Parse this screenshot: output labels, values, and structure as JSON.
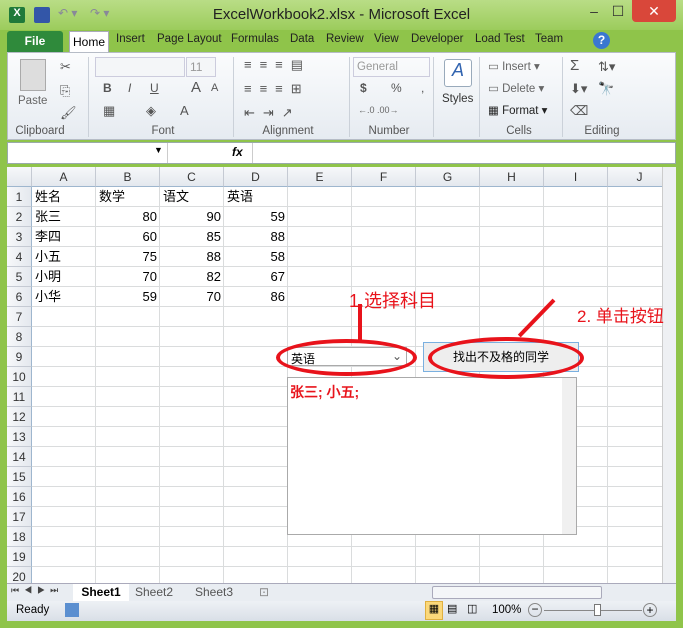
{
  "window": {
    "title": "ExcelWorkbook2.xlsx - Microsoft Excel",
    "minimize": "–",
    "maximize": "☐",
    "close": "✕"
  },
  "tabs": [
    "File",
    "Home",
    "Insert",
    "Page Layout",
    "Formulas",
    "Data",
    "Review",
    "View",
    "Developer",
    "Load Test",
    "Team"
  ],
  "ribbon": {
    "clipboard": {
      "label": "Clipboard",
      "paste": "Paste"
    },
    "font": {
      "label": "Font",
      "size": "11",
      "bold": "B",
      "italic": "I",
      "underline": "U",
      "grow": "A",
      "shrink": "A"
    },
    "alignment": {
      "label": "Alignment"
    },
    "number": {
      "label": "Number",
      "format": "General",
      "currency": "$",
      "percent": "%",
      "comma": ","
    },
    "styles": {
      "label": "Styles"
    },
    "cells": {
      "label": "Cells",
      "insert": "Insert",
      "delete": "Delete",
      "format": "Format"
    },
    "editing": {
      "label": "Editing",
      "sum": "Σ"
    }
  },
  "formula_bar": {
    "name_box": "",
    "fx": "fx",
    "value": ""
  },
  "columns": [
    "A",
    "B",
    "C",
    "D",
    "E",
    "F",
    "G",
    "H",
    "I",
    "J"
  ],
  "rows": [
    "1",
    "2",
    "3",
    "4",
    "5",
    "6",
    "7",
    "8",
    "9",
    "10",
    "11",
    "12",
    "13",
    "14",
    "15",
    "16",
    "17",
    "18",
    "19",
    "20"
  ],
  "table": {
    "headers": [
      "姓名",
      "数学",
      "语文",
      "英语"
    ],
    "data": [
      [
        "张三",
        "80",
        "90",
        "59"
      ],
      [
        "李四",
        "60",
        "85",
        "88"
      ],
      [
        "小五",
        "75",
        "88",
        "58"
      ],
      [
        "小明",
        "70",
        "82",
        "67"
      ],
      [
        "小华",
        "59",
        "70",
        "86"
      ]
    ]
  },
  "controls": {
    "subject_combo": "英语",
    "find_button": "找出不及格的同学",
    "result_text": "张三; 小五;"
  },
  "annotations": {
    "step1": "1.选择科目",
    "step2": "2. 单击按钮"
  },
  "sheets": [
    "Sheet1",
    "Sheet2",
    "Sheet3"
  ],
  "status": {
    "ready": "Ready",
    "zoom": "100%"
  },
  "colors": {
    "annotation": "#e8131b",
    "file_tab": "#2f8a3b"
  }
}
